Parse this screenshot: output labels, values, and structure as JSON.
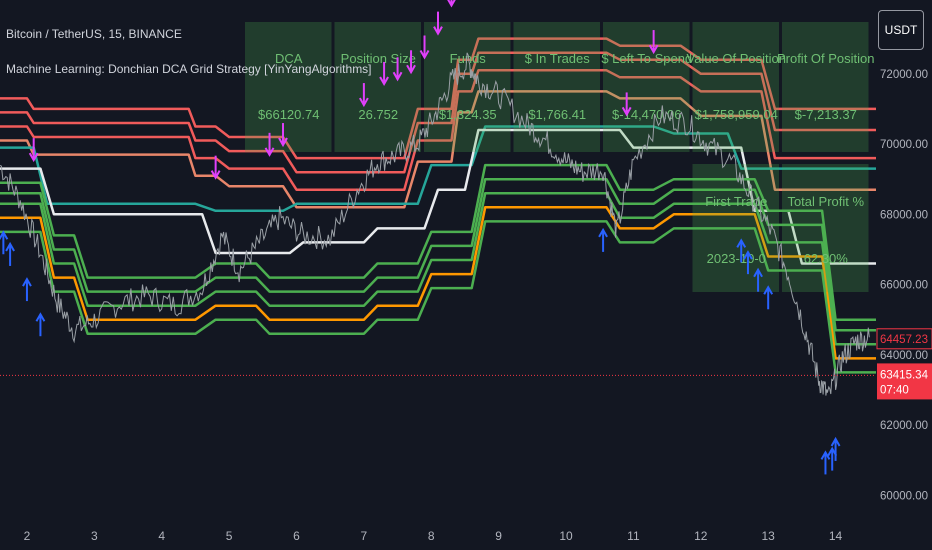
{
  "header": {
    "symbol_line": "Bitcoin / TetherUS, 15, BINANCE",
    "indicator_line": "Machine Learning: Donchian DCA Grid Strategy [YinYangAlgorithms]",
    "currency_button": "USDT"
  },
  "stats_table": {
    "columns": [
      {
        "header": "DCA",
        "value": "$66120.74"
      },
      {
        "header": "Position Size",
        "value": "26.752"
      },
      {
        "header": "Funds",
        "value": "$1,324.35"
      },
      {
        "header": "$ In Trades",
        "value": "$1,766.41"
      },
      {
        "header": "$ Left To Spend",
        "value": "$-14,470.06"
      },
      {
        "header": "Value Of Position",
        "value": "$1,758,959.04"
      },
      {
        "header": "Profit Of Position",
        "value": "$-7,213.37"
      }
    ],
    "lower": [
      {
        "header": "First Trade",
        "value": "2023-10-0"
      },
      {
        "header": "Total Profit %",
        "value": "62.30%"
      }
    ]
  },
  "price_tags": {
    "upper": "64457.23",
    "current": "63415.34",
    "countdown": "07:40"
  },
  "chart_data": {
    "type": "line",
    "x_tick_labels": [
      "2",
      "3",
      "4",
      "5",
      "6",
      "7",
      "8",
      "9",
      "10",
      "11",
      "12",
      "13",
      "14"
    ],
    "y_ticks": [
      60000,
      62000,
      64000,
      66000,
      68000,
      70000,
      72000
    ],
    "y_tick_labels": [
      "60000.00",
      "62000.00",
      "64000.00",
      "66000.00",
      "68000.00",
      "70000.00",
      "72000.00"
    ],
    "ylim": [
      59300,
      74100
    ],
    "xlim": [
      1.6,
      14.6
    ],
    "grid": false,
    "current_price": 63415.34,
    "grid_band_price": 64457.23,
    "price_series": {
      "x": [
        1.6,
        1.9,
        2.2,
        2.45,
        2.7,
        3.0,
        3.4,
        3.8,
        4.2,
        4.6,
        4.9,
        5.15,
        5.45,
        5.75,
        6.1,
        6.5,
        6.9,
        7.2,
        7.5,
        7.8,
        8.05,
        8.3,
        8.55,
        8.7,
        9.0,
        9.4,
        9.7,
        10.0,
        10.25,
        10.55,
        10.75,
        11.0,
        11.4,
        11.8,
        12.1,
        12.45,
        12.75,
        13.05,
        13.3,
        13.55,
        13.75,
        13.9,
        14.1,
        14.3,
        14.5
      ],
      "y": [
        69400,
        68400,
        66900,
        65500,
        64700,
        65000,
        65500,
        65700,
        65400,
        65900,
        67400,
        66400,
        67200,
        67900,
        67400,
        67300,
        68700,
        69500,
        69700,
        70000,
        70800,
        71800,
        72300,
        71800,
        71400,
        70600,
        70100,
        69500,
        69200,
        69300,
        67500,
        69500,
        70800,
        70600,
        70000,
        69500,
        68500,
        67500,
        66300,
        64700,
        63300,
        62800,
        63900,
        64400,
        64500
      ]
    },
    "bands": [
      {
        "color": "#f15b5b",
        "x": [
          1.6,
          2.0,
          2.1,
          4.4,
          4.5,
          4.8,
          5.0,
          5.8,
          6.0,
          7.6,
          7.8,
          8.3,
          8.4,
          8.6,
          8.7,
          10.6,
          10.8,
          11.7,
          12.0,
          12.9,
          13.1,
          14.6
        ],
        "y": [
          71300,
          71300,
          71000,
          71000,
          70500,
          70500,
          70200,
          70200,
          69600,
          69600,
          71000,
          71000,
          72400,
          72400,
          73000,
          73000,
          72800,
          72800,
          72400,
          72400,
          71000,
          71000
        ]
      },
      {
        "color": "#f15b5b",
        "x": [
          1.6,
          2.0,
          2.1,
          4.4,
          4.5,
          4.8,
          5.0,
          5.8,
          6.0,
          7.6,
          7.8,
          8.3,
          8.4,
          8.6,
          8.7,
          10.6,
          10.8,
          11.7,
          12.0,
          12.9,
          13.1,
          14.6
        ],
        "y": [
          70900,
          70900,
          70600,
          70600,
          70100,
          70100,
          69800,
          69800,
          69200,
          69200,
          70600,
          70600,
          72000,
          72000,
          72600,
          72600,
          72400,
          72400,
          72000,
          72000,
          70400,
          70400
        ]
      },
      {
        "color": "#f15b5b",
        "x": [
          1.6,
          2.0,
          2.1,
          4.4,
          4.5,
          4.8,
          5.0,
          5.8,
          6.0,
          7.6,
          7.8,
          8.3,
          8.4,
          8.6,
          8.7,
          10.6,
          10.8,
          11.7,
          12.0,
          12.9,
          13.1,
          14.6
        ],
        "y": [
          70500,
          70500,
          70200,
          70200,
          69600,
          69600,
          69300,
          69300,
          68700,
          68700,
          70100,
          70100,
          71500,
          71500,
          72100,
          72100,
          71900,
          71900,
          71500,
          71500,
          69600,
          69600
        ]
      },
      {
        "color": "#e8866a",
        "x": [
          1.6,
          2.0,
          2.1,
          4.4,
          4.5,
          4.8,
          5.0,
          5.8,
          6.0,
          7.6,
          7.8,
          8.3,
          8.4,
          8.6,
          8.7,
          10.6,
          10.8,
          11.7,
          12.0,
          12.9,
          13.1,
          14.6
        ],
        "y": [
          70100,
          70100,
          69700,
          69700,
          69100,
          69100,
          68800,
          68800,
          68200,
          68200,
          69500,
          69500,
          70900,
          70900,
          71500,
          71500,
          71300,
          71300,
          70800,
          70800,
          68700,
          68700
        ]
      },
      {
        "color": "#26a69a",
        "x": [
          1.6,
          2.1,
          2.3,
          4.5,
          4.8,
          5.8,
          6.0,
          7.8,
          8.0,
          8.6,
          8.8,
          11.3,
          11.6,
          12.4,
          12.6,
          14.6
        ],
        "y": [
          69900,
          69900,
          68300,
          68300,
          68100,
          68100,
          68300,
          68300,
          69400,
          69400,
          70500,
          70500,
          70300,
          70300,
          69300,
          69300
        ]
      },
      {
        "color": "#e8eaed",
        "x": [
          1.6,
          2.2,
          2.4,
          4.6,
          4.8,
          5.9,
          6.1,
          7.0,
          7.2,
          7.9,
          8.1,
          8.5,
          8.7,
          10.8,
          11.0,
          12.6,
          12.8,
          13.3,
          13.5,
          14.6
        ],
        "y": [
          69300,
          69300,
          68000,
          68000,
          66900,
          66900,
          67200,
          67200,
          67600,
          67600,
          68700,
          68700,
          70400,
          70400,
          69900,
          69900,
          68100,
          68100,
          66600,
          66600
        ]
      },
      {
        "color": "#4caf50",
        "x": [
          1.6,
          2.2,
          2.4,
          2.7,
          2.9,
          4.5,
          4.8,
          5.4,
          5.6,
          7.0,
          7.2,
          7.8,
          8.0,
          8.6,
          8.8,
          10.6,
          10.8,
          11.3,
          11.6,
          12.8,
          13.0,
          13.8,
          14.0,
          14.6
        ],
        "y": [
          68900,
          68900,
          67400,
          67400,
          66200,
          66200,
          66600,
          66600,
          66200,
          66200,
          66600,
          66600,
          67500,
          67500,
          69400,
          69400,
          68700,
          68700,
          69000,
          69000,
          68100,
          68100,
          65000,
          65000
        ]
      },
      {
        "color": "#4caf50",
        "x": [
          1.6,
          2.2,
          2.4,
          2.7,
          2.9,
          4.5,
          4.8,
          5.4,
          5.6,
          7.0,
          7.2,
          7.8,
          8.0,
          8.6,
          8.8,
          10.6,
          10.8,
          11.3,
          11.6,
          12.8,
          13.0,
          13.8,
          14.0,
          14.6
        ],
        "y": [
          68600,
          68600,
          67000,
          67000,
          65800,
          65800,
          66200,
          66200,
          65800,
          65800,
          66200,
          66200,
          67100,
          67100,
          69000,
          69000,
          68300,
          68300,
          68700,
          68700,
          67700,
          67700,
          64700,
          64700
        ]
      },
      {
        "color": "#4caf50",
        "x": [
          1.6,
          2.2,
          2.4,
          2.7,
          2.9,
          4.5,
          4.8,
          5.4,
          5.6,
          7.0,
          7.2,
          7.8,
          8.0,
          8.6,
          8.8,
          10.6,
          10.8,
          11.3,
          11.6,
          12.8,
          13.0,
          13.8,
          14.0,
          14.6
        ],
        "y": [
          68300,
          68300,
          66600,
          66600,
          65400,
          65400,
          65800,
          65800,
          65400,
          65400,
          65800,
          65800,
          66700,
          66700,
          68600,
          68600,
          67900,
          67900,
          68300,
          68300,
          67200,
          67200,
          64300,
          64300
        ]
      },
      {
        "color": "#ff9800",
        "x": [
          1.6,
          2.2,
          2.4,
          2.7,
          2.9,
          4.5,
          4.8,
          5.4,
          5.6,
          7.0,
          7.2,
          7.8,
          8.0,
          8.6,
          8.8,
          10.6,
          10.8,
          11.3,
          11.6,
          12.8,
          13.0,
          13.8,
          14.0,
          14.6
        ],
        "y": [
          67900,
          67900,
          66200,
          66200,
          65000,
          65000,
          65400,
          65400,
          65000,
          65000,
          65400,
          65400,
          66300,
          66300,
          68200,
          68200,
          67600,
          67600,
          68000,
          68000,
          66800,
          66800,
          63900,
          63900
        ]
      },
      {
        "color": "#4caf50",
        "x": [
          1.6,
          2.2,
          2.4,
          2.7,
          2.9,
          4.5,
          4.8,
          5.4,
          5.6,
          7.0,
          7.2,
          7.8,
          8.0,
          8.6,
          8.8,
          10.6,
          10.8,
          11.3,
          11.6,
          12.8,
          13.0,
          13.8,
          14.0,
          14.6
        ],
        "y": [
          67500,
          67500,
          65800,
          65800,
          64600,
          64600,
          65000,
          65000,
          64600,
          64600,
          65000,
          65000,
          65900,
          65900,
          67800,
          67800,
          67200,
          67200,
          67600,
          67600,
          66400,
          66400,
          63500,
          63500
        ]
      }
    ],
    "sell_signal_x": [
      2.1,
      4.8,
      5.6,
      5.8,
      7.0,
      7.3,
      7.5,
      7.7,
      7.9,
      8.1,
      8.3,
      8.6,
      10.9,
      11.3
    ],
    "buy_signal_x": [
      1.65,
      1.75,
      2.0,
      2.2,
      10.55,
      12.6,
      12.7,
      12.85,
      13.0,
      13.85,
      13.95,
      14.0
    ]
  }
}
